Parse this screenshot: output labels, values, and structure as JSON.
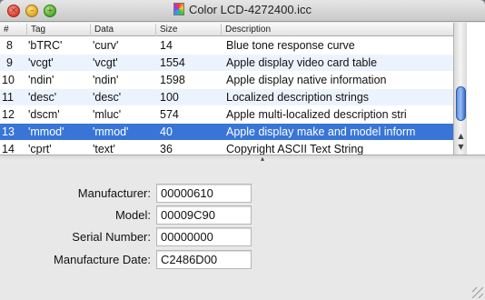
{
  "window": {
    "title": "Color LCD-4272400.icc",
    "traffic": {
      "close_glyph": "×",
      "minimize_glyph": "–",
      "zoom_glyph": "+"
    }
  },
  "table": {
    "columns": [
      "#",
      "Tag",
      "Data",
      "Size",
      "Description"
    ],
    "rows": [
      {
        "num": "8",
        "tag": "'bTRC'",
        "data": "'curv'",
        "size": "14",
        "desc": "Blue tone response curve"
      },
      {
        "num": "9",
        "tag": "'vcgt'",
        "data": "'vcgt'",
        "size": "1554",
        "desc": "Apple display video card table"
      },
      {
        "num": "10",
        "tag": "'ndin'",
        "data": "'ndin'",
        "size": "1598",
        "desc": "Apple display native information"
      },
      {
        "num": "11",
        "tag": "'desc'",
        "data": "'desc'",
        "size": "100",
        "desc": "Localized description strings"
      },
      {
        "num": "12",
        "tag": "'dscm'",
        "data": "'mluc'",
        "size": "574",
        "desc": "Apple multi-localized description stri"
      },
      {
        "num": "13",
        "tag": "'mmod'",
        "data": "'mmod'",
        "size": "40",
        "desc": "Apple display make and model inform"
      },
      {
        "num": "14",
        "tag": "'cprt'",
        "data": "'text'",
        "size": "36",
        "desc": "Copyright ASCII Text String"
      }
    ],
    "selected_row": 5
  },
  "details": {
    "fields": [
      {
        "label": "Manufacturer:",
        "value": "00000610"
      },
      {
        "label": "Model:",
        "value": "00009C90"
      },
      {
        "label": "Serial Number:",
        "value": "00000000"
      },
      {
        "label": "Manufacture Date:",
        "value": "C2486D00"
      }
    ]
  },
  "icons": {
    "scroll_up": "▲",
    "scroll_down": "▼",
    "splitter": "▴"
  },
  "colors": {
    "selection": "#3875d7",
    "alt_row": "#edf3fe"
  }
}
